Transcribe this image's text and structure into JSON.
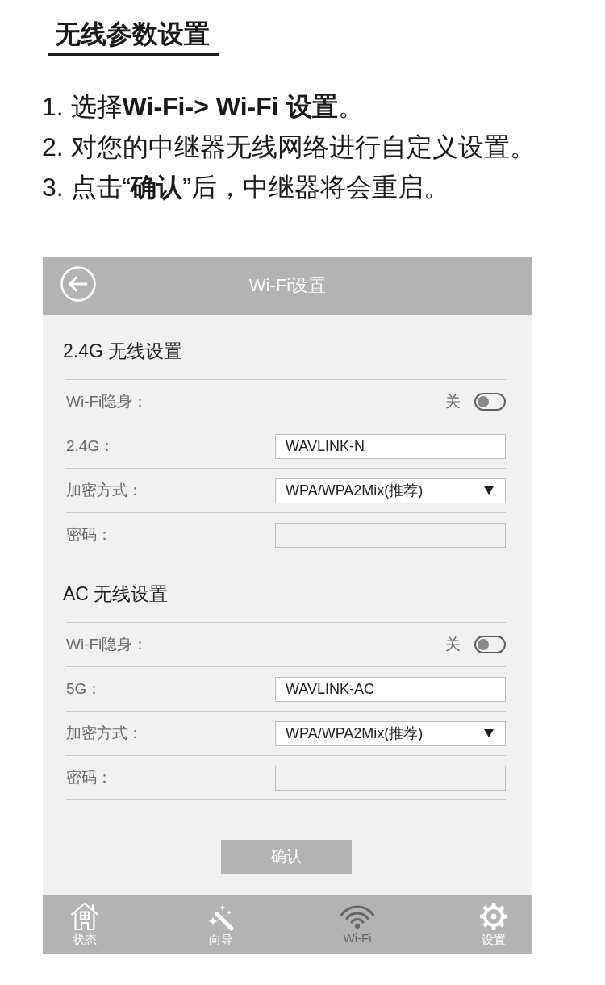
{
  "heading": "无线参数设置",
  "steps": [
    "1. 选择**Wi-Fi-> Wi-Fi 设置**。",
    "2. 对您的中继器无线网络进行自定义设置。",
    "3. 点击“**确认**”后，中继器将会重启。"
  ],
  "phone": {
    "header": {
      "title": "Wi-Fi设置"
    },
    "sections": [
      {
        "title": "2.4G 无线设置",
        "rows": [
          {
            "kind": "toggle",
            "label": "Wi-Fi隐身：",
            "state_label": "关",
            "on": false
          },
          {
            "kind": "text",
            "label": "2.4G：",
            "value": "WAVLINK-N"
          },
          {
            "kind": "select",
            "label": "加密方式：",
            "value": "WPA/WPA2Mix(推荐)"
          },
          {
            "kind": "password",
            "label": "密码："
          }
        ]
      },
      {
        "title": "AC 无线设置",
        "rows": [
          {
            "kind": "toggle",
            "label": "Wi-Fi隐身：",
            "state_label": "关",
            "on": false
          },
          {
            "kind": "text",
            "label": "5G：",
            "value": "WAVLINK-AC"
          },
          {
            "kind": "select",
            "label": "加密方式：",
            "value": "WPA/WPA2Mix(推荐)"
          },
          {
            "kind": "password",
            "label": "密码："
          }
        ]
      }
    ],
    "confirm_button": "确认",
    "nav": [
      {
        "label": "状态",
        "selected": false
      },
      {
        "label": "向导",
        "selected": false
      },
      {
        "label": "Wi-Fi",
        "selected": true
      },
      {
        "label": "设置",
        "selected": false
      }
    ]
  }
}
